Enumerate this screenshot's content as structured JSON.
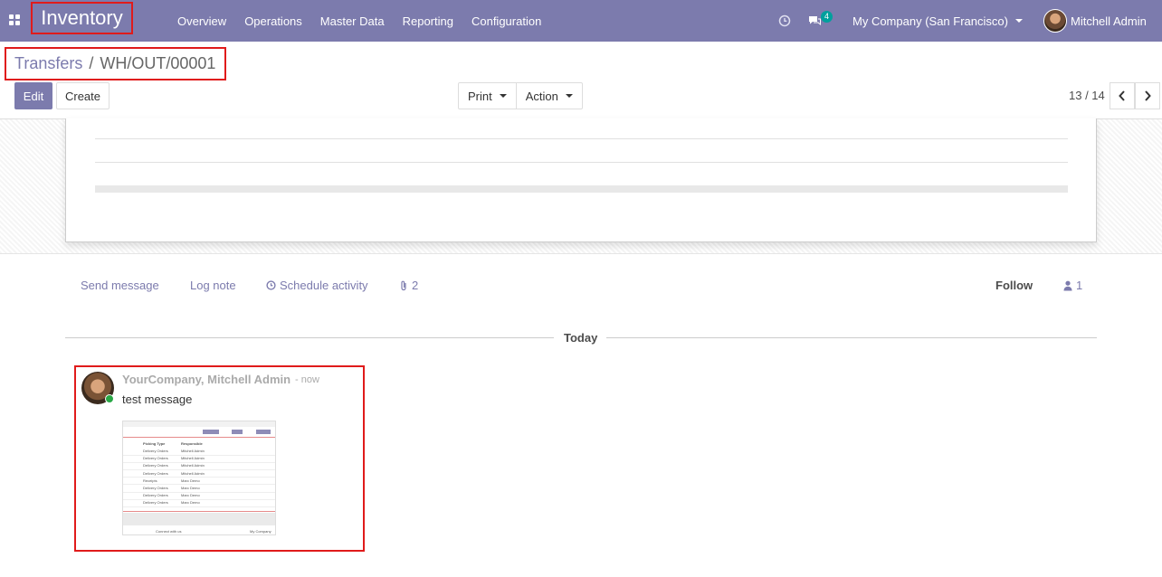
{
  "navbar": {
    "app_title": "Inventory",
    "menu": [
      "Overview",
      "Operations",
      "Master Data",
      "Reporting",
      "Configuration"
    ],
    "chat_badge": "4",
    "company": "My Company (San Francisco)",
    "user": "Mitchell Admin",
    "colors": {
      "bar": "#7c7bad",
      "badge": "#00a09d"
    }
  },
  "breadcrumb": {
    "parent": "Transfers",
    "separator": "/",
    "current": "WH/OUT/00001"
  },
  "toolbar": {
    "edit_label": "Edit",
    "create_label": "Create",
    "print_label": "Print",
    "action_label": "Action"
  },
  "pager": {
    "value": "13 / 14"
  },
  "chatter": {
    "send_message": "Send message",
    "log_note": "Log note",
    "schedule_activity": "Schedule activity",
    "attachments_count": "2",
    "follow": "Follow",
    "followers_count": "1"
  },
  "timeline": {
    "date_separator": "Today",
    "message": {
      "author": "YourCompany, Mitchell Admin",
      "time": "now",
      "body": "test message",
      "attachment": {
        "headers": [
          "Picking Type",
          "Responsible"
        ],
        "rows": [
          [
            "Delivery Orders",
            "Mitchell Admin"
          ],
          [
            "Delivery Orders",
            "Mitchell Admin"
          ],
          [
            "Delivery Orders",
            "Mitchell Admin"
          ],
          [
            "Delivery Orders",
            "Mitchell Admin"
          ],
          [
            "Receipts",
            "Marc Demo"
          ],
          [
            "Delivery Orders",
            "Marc Demo"
          ],
          [
            "Delivery Orders",
            "Marc Demo"
          ],
          [
            "Delivery Orders",
            "Marc Demo"
          ]
        ],
        "footer_left": "Connect with us",
        "footer_right": "My Company"
      }
    }
  }
}
